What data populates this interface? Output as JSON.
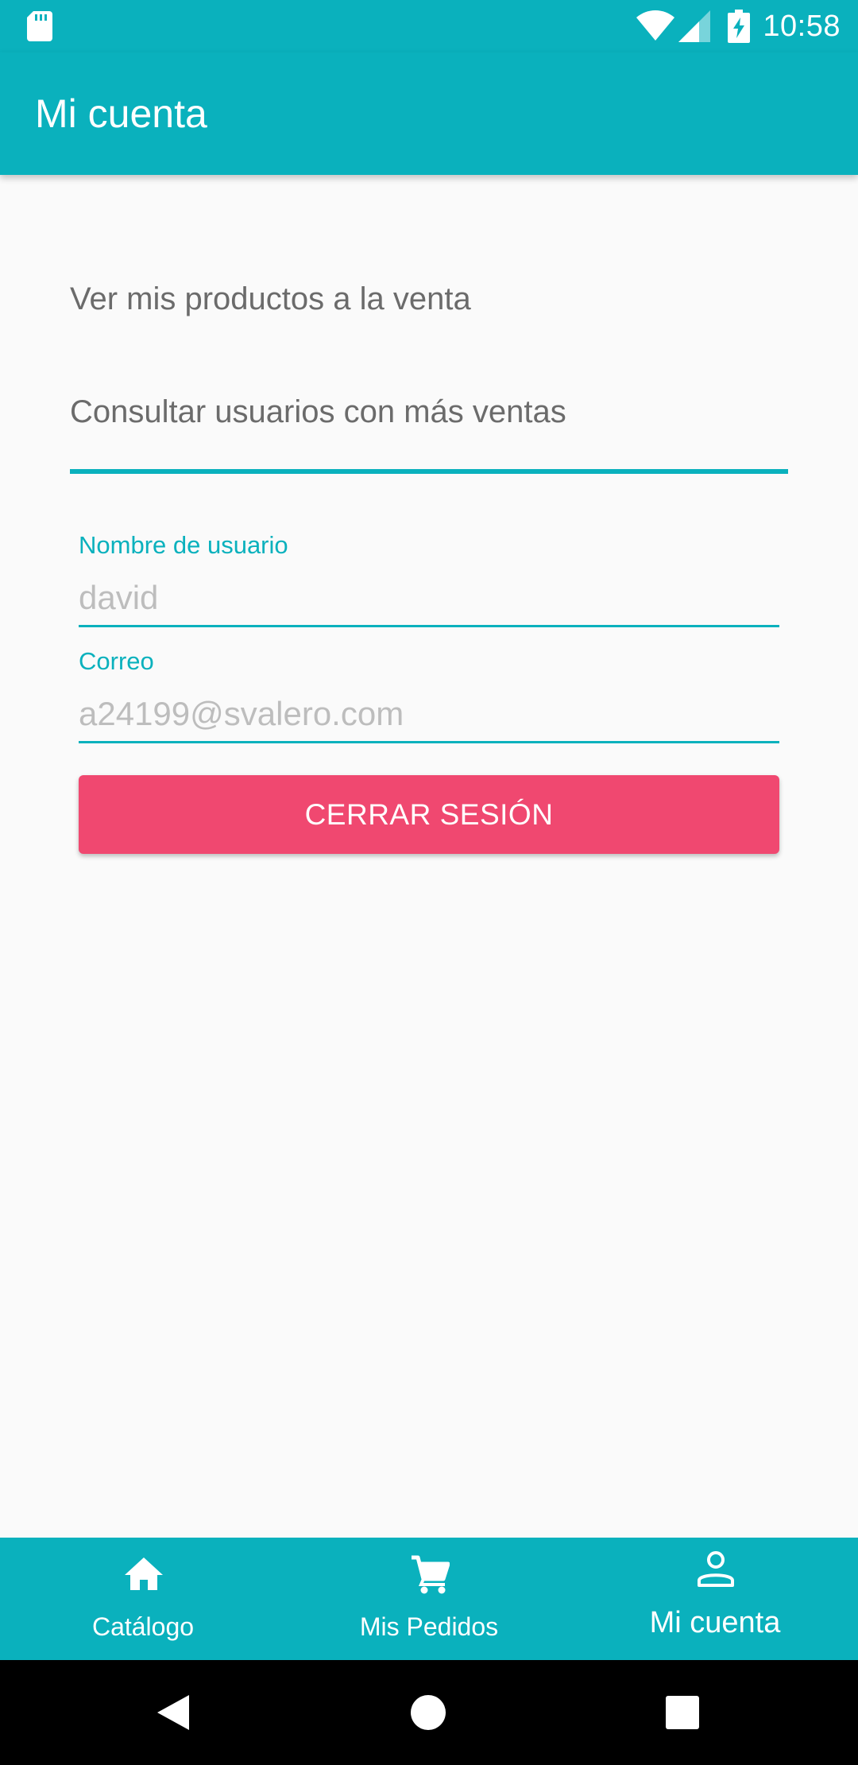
{
  "status_bar": {
    "time": "10:58",
    "icons": [
      "sd-card-icon",
      "wifi-icon",
      "signal-icon",
      "battery-charging-icon"
    ]
  },
  "app_bar": {
    "title": "Mi cuenta"
  },
  "menu": {
    "items": [
      {
        "label": "Ver mis productos a la venta"
      },
      {
        "label": "Consultar usuarios con más ventas"
      }
    ]
  },
  "profile": {
    "username_label": "Nombre de usuario",
    "username_value": "david",
    "email_label": "Correo",
    "email_value": "a24199@svalero.com"
  },
  "logout_button": {
    "label": "CERRAR SESIÓN"
  },
  "bottom_nav": {
    "items": [
      {
        "label": "Catálogo",
        "icon": "home-icon",
        "active": false
      },
      {
        "label": "Mis Pedidos",
        "icon": "cart-icon",
        "active": false
      },
      {
        "label": "Mi cuenta",
        "icon": "person-icon",
        "active": true
      }
    ]
  },
  "system_nav": {
    "icons": [
      "back-icon",
      "home-circle-icon",
      "recents-icon"
    ]
  },
  "colors": {
    "primary": "#0ab1bd",
    "accent": "#f04870",
    "background": "#fafafa",
    "menu_text": "#6b6b6b",
    "field_value_text": "#bdbdbd"
  }
}
